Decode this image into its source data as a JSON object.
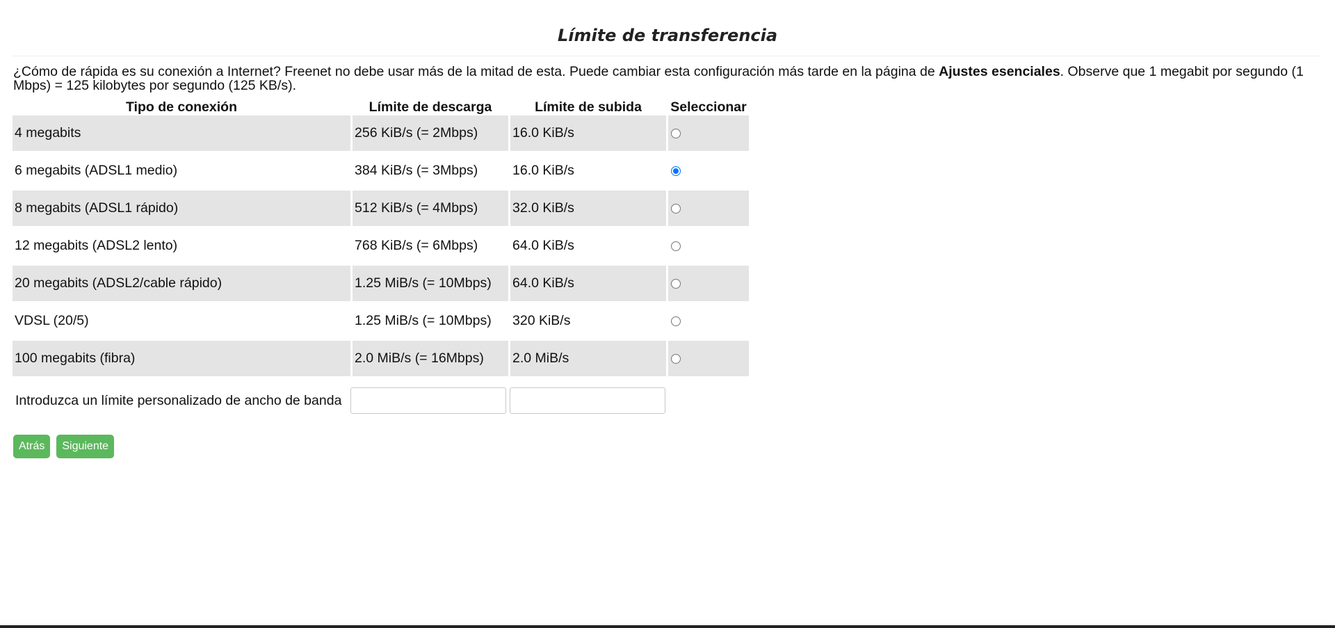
{
  "page": {
    "title": "Límite de transferencia",
    "intro_before": "¿Cómo de rápida es su conexión a Internet? Freenet no debe usar más de la mitad de esta. Puede cambiar esta configuración más tarde en la página de ",
    "intro_bold": "Ajustes esenciales",
    "intro_after": ". Observe que 1 megabit por segundo (1 Mbps) = 125 kilobytes por segundo (125 KB/s)."
  },
  "table": {
    "headers": {
      "type": "Tipo de conexión",
      "download": "Límite de descarga",
      "upload": "Límite de subida",
      "select": "Seleccionar"
    },
    "rows": [
      {
        "type": "4 megabits",
        "download": "256 KiB/s (= 2Mbps)",
        "upload": "16.0 KiB/s",
        "selected": false
      },
      {
        "type": "6 megabits (ADSL1 medio)",
        "download": "384 KiB/s (= 3Mbps)",
        "upload": "16.0 KiB/s",
        "selected": true
      },
      {
        "type": "8 megabits (ADSL1 rápido)",
        "download": "512 KiB/s (= 4Mbps)",
        "upload": "32.0 KiB/s",
        "selected": false
      },
      {
        "type": "12 megabits (ADSL2 lento)",
        "download": "768 KiB/s (= 6Mbps)",
        "upload": "64.0 KiB/s",
        "selected": false
      },
      {
        "type": "20 megabits (ADSL2/cable rápido)",
        "download": "1.25 MiB/s (= 10Mbps)",
        "upload": "64.0 KiB/s",
        "selected": false
      },
      {
        "type": "VDSL (20/5)",
        "download": "1.25 MiB/s (= 10Mbps)",
        "upload": "320 KiB/s",
        "selected": false
      },
      {
        "type": "100 megabits (fibra)",
        "download": "2.0 MiB/s (= 16Mbps)",
        "upload": "2.0 MiB/s",
        "selected": false
      }
    ]
  },
  "custom": {
    "label": "Introduzca un límite personalizado de ancho de banda",
    "download_value": "",
    "upload_value": ""
  },
  "buttons": {
    "back": "Atrás",
    "next": "Siguiente"
  },
  "colors": {
    "button_bg": "#5cb85c",
    "row_shade": "#e4e4e4",
    "radio_accent": "#0075ff"
  }
}
